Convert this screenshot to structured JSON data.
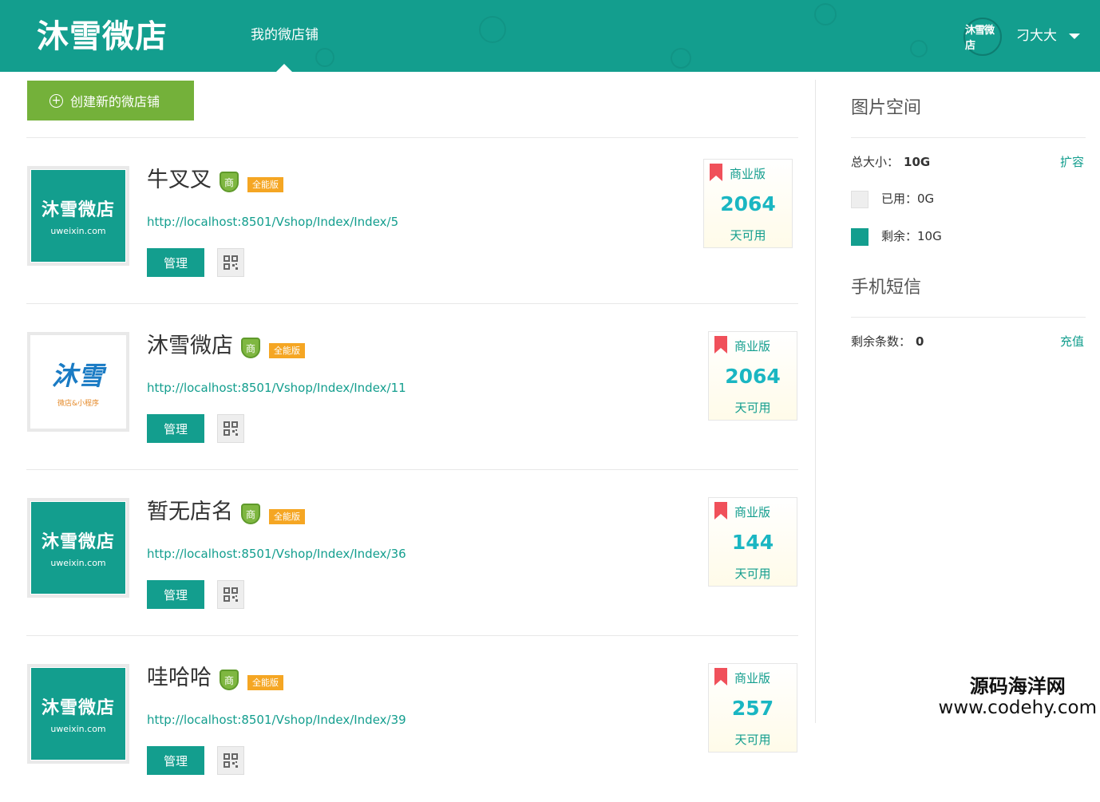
{
  "header": {
    "brand": "沐雪微店",
    "nav_label": "我的微店铺",
    "avatar_text": "沐雪微店",
    "user_name": "刁大大"
  },
  "create_button": {
    "label": "创建新的微店铺"
  },
  "shops": [
    {
      "name": "牛叉叉",
      "merchant_badge": "商",
      "edition_badge": "全能版",
      "url": "http://localhost:8501/Vshop/Index/Index/5",
      "logo_text": "沐雪微店",
      "logo_sub": "uweixin.com",
      "manage_label": "管理",
      "edition_label": "商业版",
      "days": "2064",
      "days_label": "天可用"
    },
    {
      "name": "沐雪微店",
      "merchant_badge": "商",
      "edition_badge": "全能版",
      "url": "http://localhost:8501/Vshop/Index/Index/11",
      "logo_text": "沐雪",
      "logo_sub": "微店&小程序",
      "manage_label": "管理",
      "edition_label": "商业版",
      "days": "2064",
      "days_label": "天可用"
    },
    {
      "name": "暂无店名",
      "merchant_badge": "商",
      "edition_badge": "全能版",
      "url": "http://localhost:8501/Vshop/Index/Index/36",
      "logo_text": "沐雪微店",
      "logo_sub": "uweixin.com",
      "manage_label": "管理",
      "edition_label": "商业版",
      "days": "144",
      "days_label": "天可用"
    },
    {
      "name": "哇哈哈",
      "merchant_badge": "商",
      "edition_badge": "全能版",
      "url": "http://localhost:8501/Vshop/Index/Index/39",
      "logo_text": "沐雪微店",
      "logo_sub": "uweixin.com",
      "manage_label": "管理",
      "edition_label": "商业版",
      "days": "257",
      "days_label": "天可用"
    }
  ],
  "sidebar": {
    "image_space": {
      "title": "图片空间",
      "total_label": "总大小：",
      "total_value": "10G",
      "expand_link": "扩容",
      "used_label": "已用：0G",
      "remaining_label": "剩余：10G"
    },
    "sms": {
      "title": "手机短信",
      "remaining_label": "剩余条数：",
      "remaining_value": "0",
      "recharge_link": "充值"
    }
  },
  "watermark": {
    "line1": "源码海洋网",
    "line2": "www.codehy.com"
  },
  "colors": {
    "primary": "#139e8e",
    "create_button": "#74b13a",
    "edition_badge": "#f5a623",
    "days": "#1ab6c2",
    "flag": "#f0505a"
  }
}
